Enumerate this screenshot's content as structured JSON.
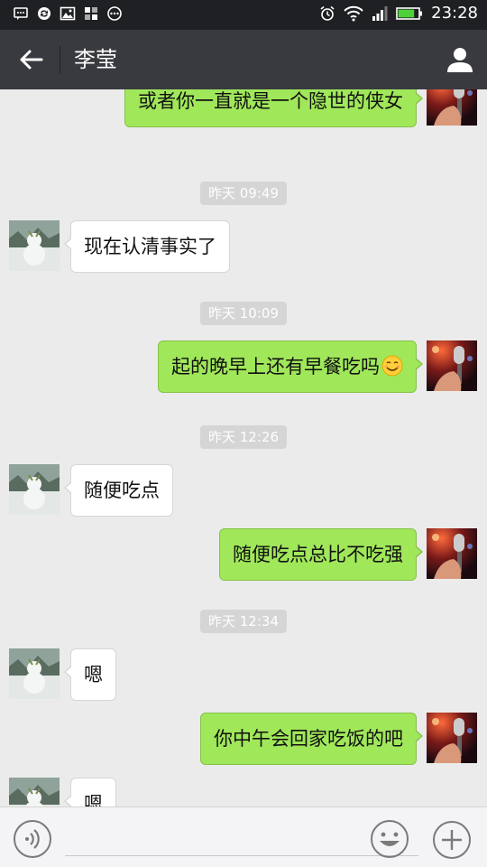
{
  "status_bar": {
    "time": "23:28",
    "left_icons": [
      "message-icon",
      "sync-icon",
      "image-icon",
      "apps-icon",
      "more-circle-icon"
    ],
    "right_icons": [
      "alarm-icon",
      "wifi-icon",
      "signal-icon",
      "battery-icon"
    ],
    "battery_level": 0.8
  },
  "header": {
    "title": "李莹",
    "back_icon": "arrow-left-icon",
    "profile_icon": "user-icon"
  },
  "messages": [
    {
      "type": "out",
      "text": "或者你一直就是一个隐世的侠女"
    },
    {
      "type": "time",
      "text": "昨天 09:49"
    },
    {
      "type": "in",
      "text": "现在认清事实了"
    },
    {
      "type": "time",
      "text": "昨天 10:09"
    },
    {
      "type": "out",
      "text": "起的晚早上还有早餐吃吗",
      "emoji": "smile-emoji"
    },
    {
      "type": "time",
      "text": "昨天 12:26"
    },
    {
      "type": "in",
      "text": "随便吃点"
    },
    {
      "type": "out",
      "text": "随便吃点总比不吃强"
    },
    {
      "type": "time",
      "text": "昨天 12:34"
    },
    {
      "type": "in",
      "text": "嗯"
    },
    {
      "type": "out",
      "text": "你中午会回家吃饭的吧"
    },
    {
      "type": "in",
      "text": "嗯"
    }
  ],
  "input_bar": {
    "voice_icon": "voice-icon",
    "text_value": "",
    "emoji_icon": "emoji-icon",
    "plus_icon": "plus-icon"
  },
  "colors": {
    "status_bar_bg": "#1f2023",
    "title_bar_bg": "#393a3f",
    "chat_bg": "#ebebeb",
    "outgoing_bubble": "#a0e75a",
    "incoming_bubble": "#ffffff",
    "battery_fill": "#4cd137"
  }
}
